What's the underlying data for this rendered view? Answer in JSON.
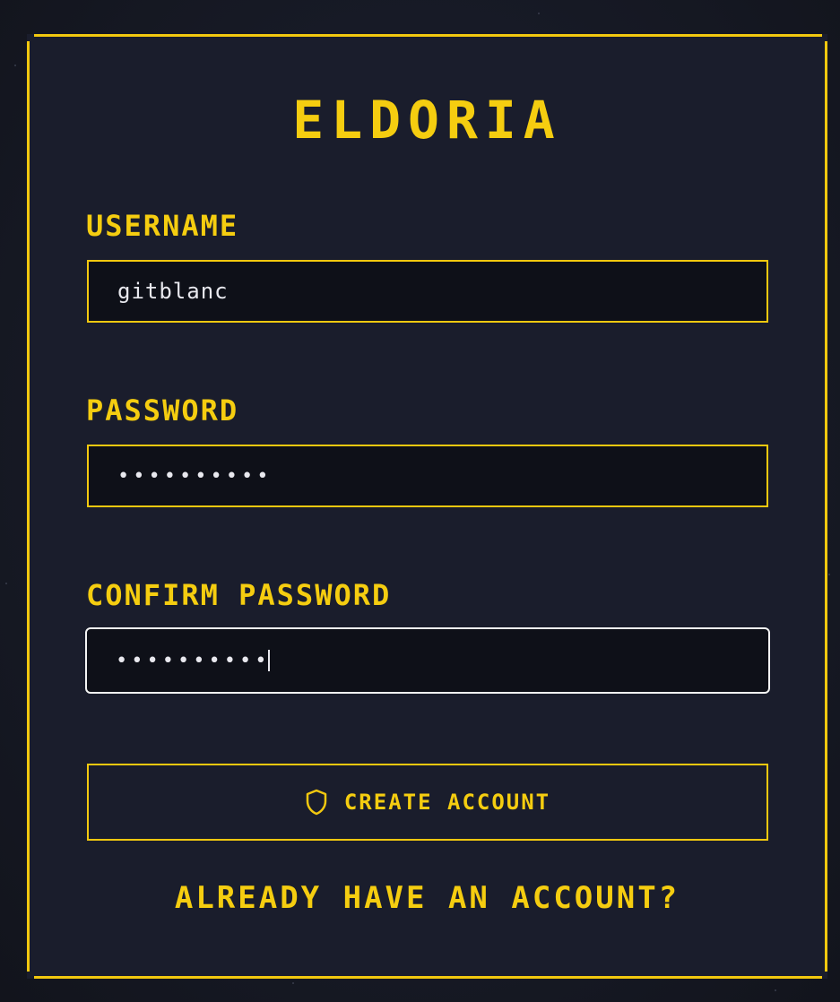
{
  "app": {
    "title": "ELDORIA"
  },
  "form": {
    "username": {
      "label": "USERNAME",
      "value": "gitblanc"
    },
    "password": {
      "label": "PASSWORD",
      "masked_value": "••••••••••"
    },
    "confirm_password": {
      "label": "CONFIRM PASSWORD",
      "masked_value": "••••••••••"
    },
    "submit": {
      "label": "CREATE ACCOUNT",
      "icon": "shield-icon"
    },
    "login_link": {
      "label": "ALREADY HAVE AN ACCOUNT?"
    }
  },
  "colors": {
    "accent": "#f2c80f",
    "panel_bg": "#1a1d2c",
    "field_bg": "#0e1018",
    "page_bg": "#14161f",
    "focus_border": "#f4f4f4"
  }
}
